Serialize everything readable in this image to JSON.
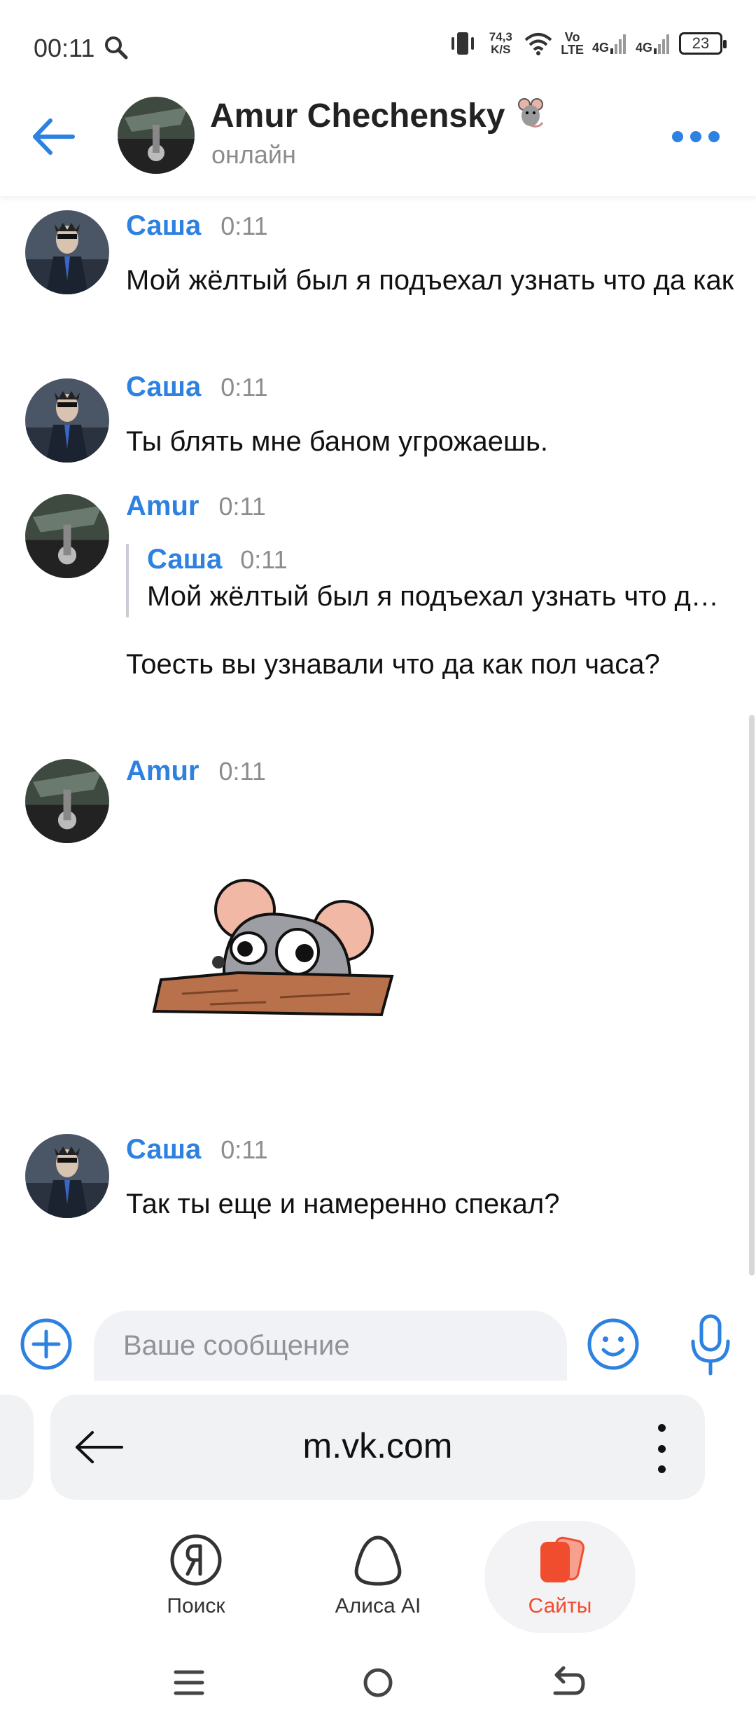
{
  "status": {
    "time": "00:11",
    "speed_value": "74,3",
    "speed_unit": "K/S",
    "volte_top": "Vo",
    "volte_bottom": "LTE",
    "net1": "4G",
    "net2": "4G",
    "battery": "23"
  },
  "header": {
    "name": "Amur Chechensky",
    "status": "онлайн"
  },
  "messages": [
    {
      "author": "Саша",
      "time": "0:11",
      "text": "Мой жёлтый был я подъехал узнать что да как"
    },
    {
      "author": "Саша",
      "time": "0:11",
      "text": "Ты блять мне баном угрожаешь."
    },
    {
      "author": "Amur",
      "time": "0:11",
      "reply_author": "Саша",
      "reply_time": "0:11",
      "reply_text": "Мой жёлтый был я подъехал узнать что да как",
      "text": "Тоесть вы узнавали что да как пол часа?"
    },
    {
      "author": "Amur",
      "time": "0:11",
      "sticker": "rat-peeking-sticker"
    },
    {
      "author": "Саша",
      "time": "0:11",
      "text": "Так ты еще и намеренно спекал?"
    }
  ],
  "composer": {
    "placeholder": "Ваше сообщение"
  },
  "browser": {
    "url": "m.vk.com"
  },
  "nav": {
    "search": "Поиск",
    "alice": "Алиса AI",
    "sites": "Сайты"
  },
  "colors": {
    "accent": "#2d81e0",
    "active_tab": "#f04d2f"
  }
}
